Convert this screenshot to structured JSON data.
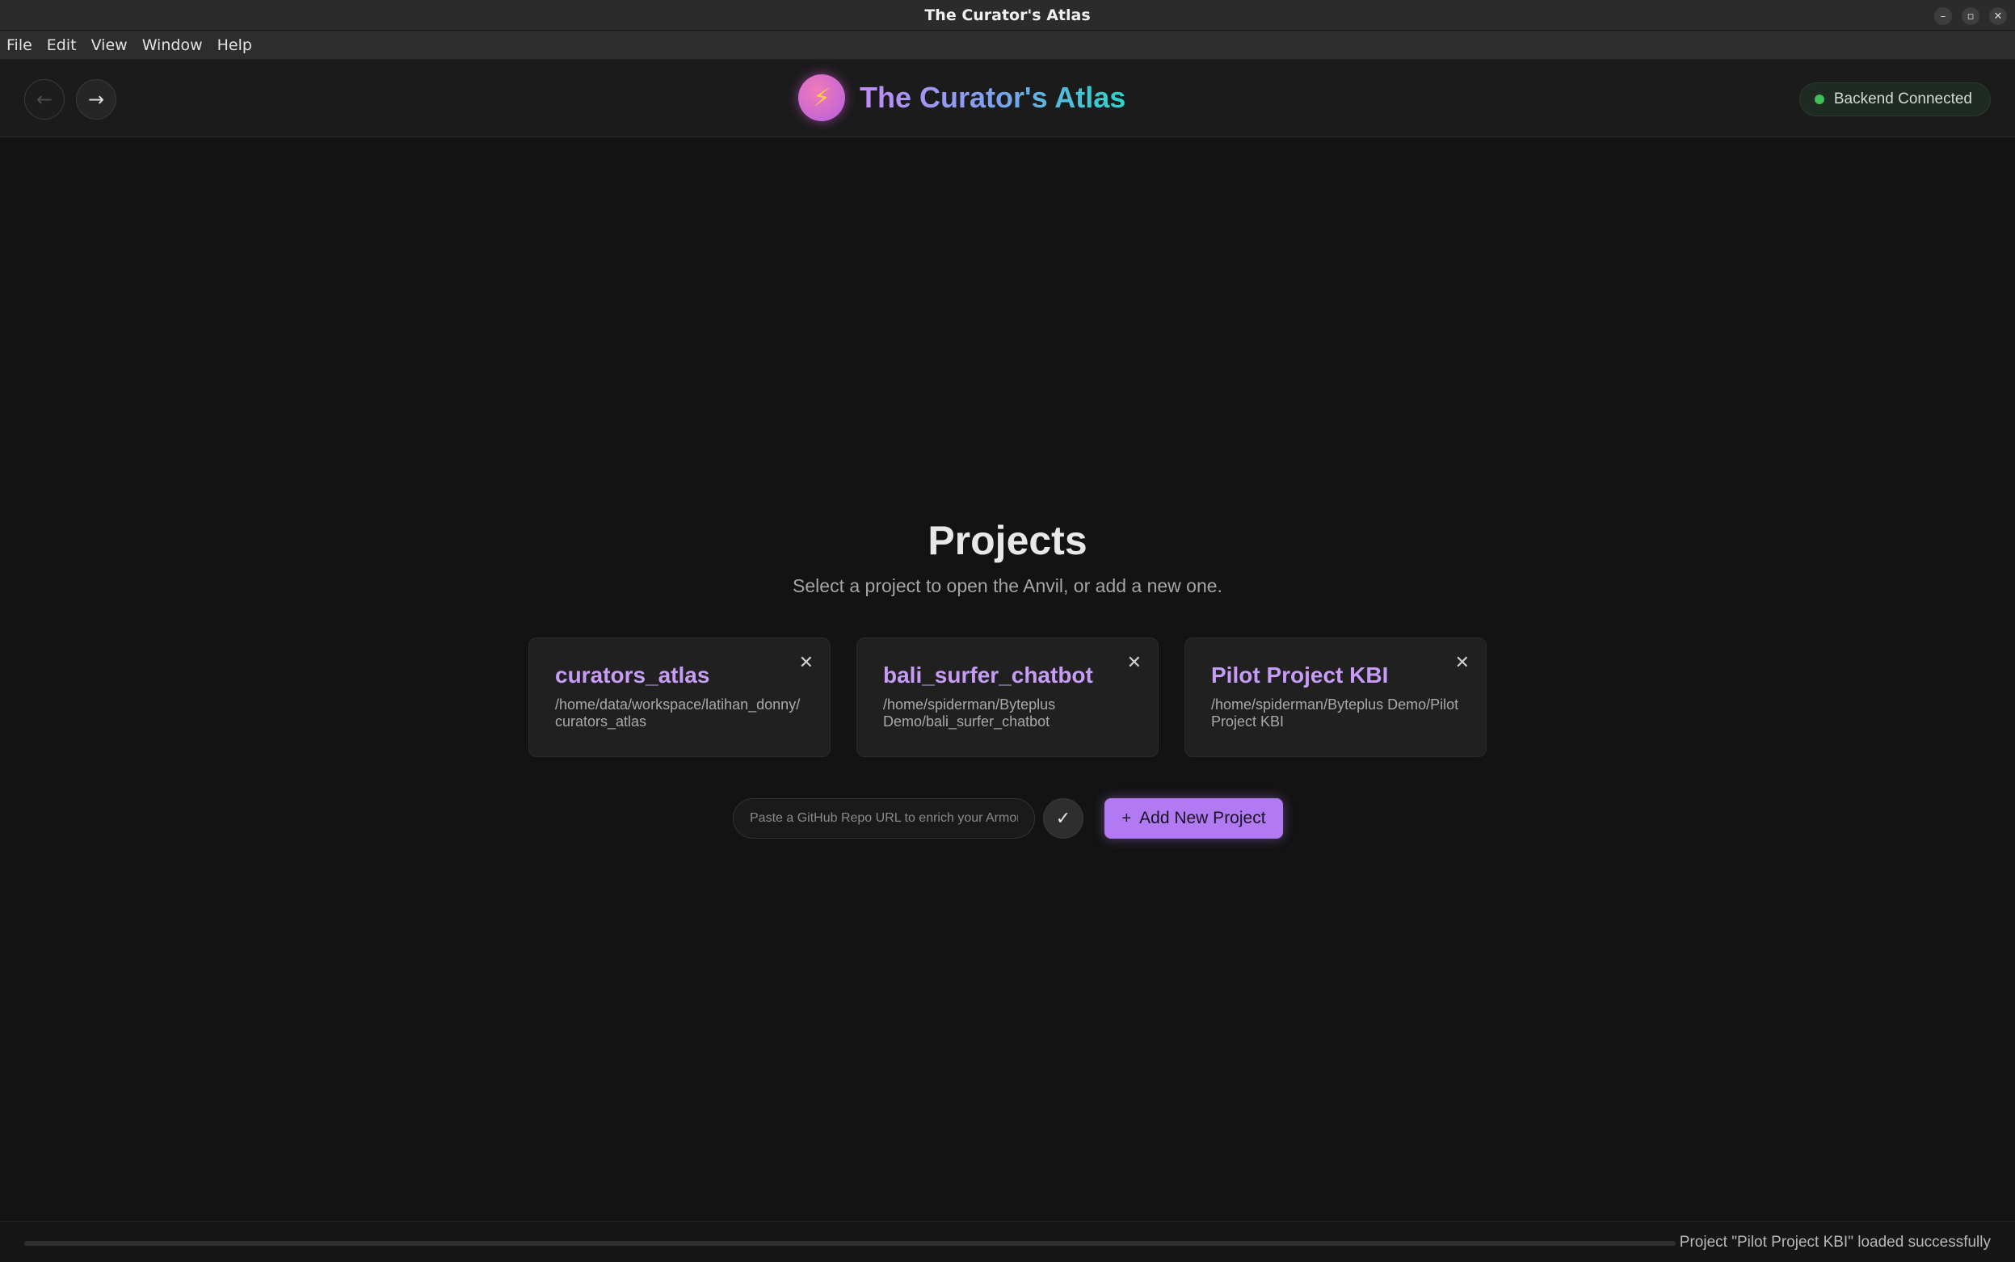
{
  "window": {
    "title": "The Curator's Atlas",
    "controls": {
      "minimize": "–",
      "maximize": "▫",
      "close": "✕"
    }
  },
  "menu": [
    "File",
    "Edit",
    "View",
    "Window",
    "Help"
  ],
  "header": {
    "back_icon": "←",
    "forward_icon": "→",
    "logo_glyph": "⚡",
    "app_name": "The Curator's Atlas",
    "status": "Backend Connected",
    "status_color": "#3fbf55"
  },
  "main": {
    "title": "Projects",
    "subtitle": "Select a project to open the Anvil, or add a new one.",
    "projects": [
      {
        "name": "curators_atlas",
        "path_line1": "/home/data/workspace/latihan_donny/",
        "path_line2": "curators_atlas"
      },
      {
        "name": "bali_surfer_chatbot",
        "path_line1": "/home/spiderman/Byteplus",
        "path_line2": "Demo/bali_surfer_chatbot"
      },
      {
        "name": "Pilot Project KBI",
        "path_line1": "/home/spiderman/Byteplus Demo/Pilot",
        "path_line2": "Project KBI"
      }
    ],
    "close_icon": "✕",
    "url_placeholder": "Paste a GitHub Repo URL to enrich your Armory",
    "confirm_icon": "✓",
    "add_plus": "+",
    "add_label": "Add New Project",
    "accent": "#b17af2"
  },
  "footer": {
    "progress": 0,
    "message": "Project \"Pilot Project KBI\" loaded successfully"
  }
}
